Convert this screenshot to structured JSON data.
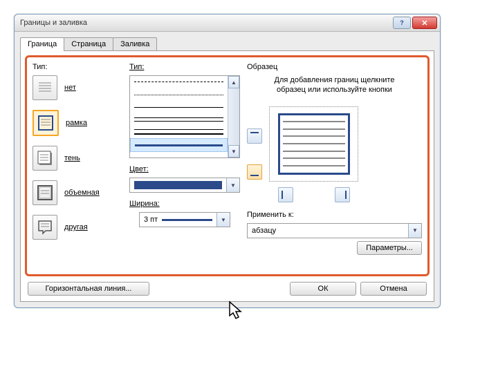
{
  "dialog": {
    "title": "Границы и заливка"
  },
  "tabs": {
    "border": "Граница",
    "page": "Страница",
    "fill": "Заливка"
  },
  "type": {
    "label": "Тип:",
    "items": [
      {
        "label": "нет"
      },
      {
        "label": "рамка"
      },
      {
        "label": "тень"
      },
      {
        "label": "объемная"
      },
      {
        "label": "другая"
      }
    ]
  },
  "style": {
    "label": "Тип:",
    "color_label": "Цвет:",
    "width_label": "Ширина:",
    "width_value": "3 пт"
  },
  "preview": {
    "label": "Образец",
    "hint": "Для добавления границ щелкните образец или используйте кнопки",
    "apply_label": "Применить к:",
    "apply_value": "абзацу",
    "options_btn": "Параметры..."
  },
  "footer": {
    "hline": "Горизонтальная линия...",
    "ok": "ОК",
    "cancel": "Отмена"
  }
}
